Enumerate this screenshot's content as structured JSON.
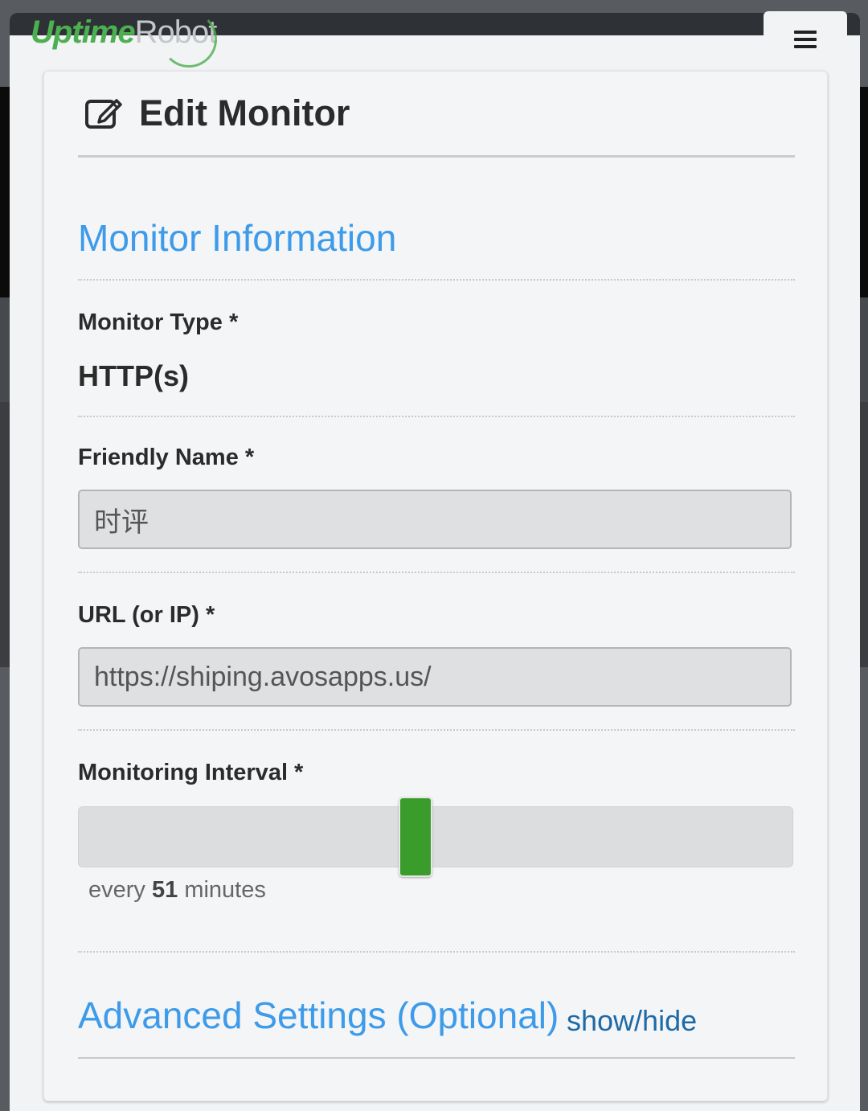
{
  "header": {
    "logo_part1": "Uptime",
    "logo_part2": "Robot",
    "menu_icon": "hamburger-menu-icon"
  },
  "card": {
    "title": "Edit Monitor",
    "title_icon": "edit-icon"
  },
  "monitor_info": {
    "section_title": "Monitor Information",
    "type_label": "Monitor Type *",
    "type_value": "HTTP(s)",
    "friendly_name_label": "Friendly Name *",
    "friendly_name_value": "时评",
    "url_label": "URL (or IP) *",
    "url_value": "https://shiping.avosapps.us/",
    "interval_label": "Monitoring Interval *",
    "interval_prefix": "every",
    "interval_value": "51",
    "interval_suffix": "minutes",
    "interval_slider_fraction": 0.47
  },
  "advanced": {
    "title": "Advanced Settings (Optional)",
    "toggle_link": "show/hide"
  },
  "colors": {
    "accent_blue": "#3d9be9",
    "link_blue": "#1e6aa6",
    "slider_green": "#3a9c2a",
    "logo_green": "#4caf50"
  }
}
